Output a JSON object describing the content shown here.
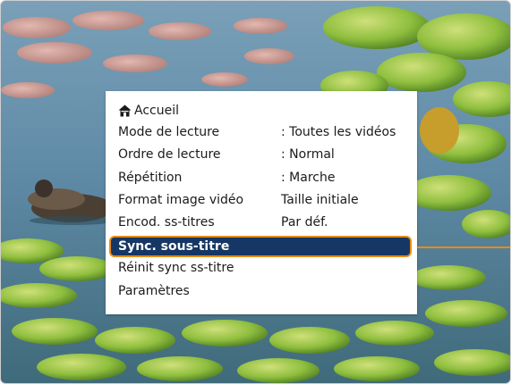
{
  "menu": {
    "items": [
      {
        "label": "Accueil",
        "value": "",
        "icon": "home-icon"
      },
      {
        "label": "Mode de lecture",
        "value": ": Toutes les vidéos"
      },
      {
        "label": "Ordre de lecture",
        "value": ": Normal"
      },
      {
        "label": "Répétition",
        "value": ": Marche"
      },
      {
        "label": "Format image vidéo",
        "value": "Taille initiale"
      },
      {
        "label": "Encod. ss-titres",
        "value": "Par déf."
      },
      {
        "label": "Sync. sous-titre",
        "value": "",
        "selected": true
      },
      {
        "label": "Réinit sync ss-titre",
        "value": ""
      },
      {
        "label": "Paramètres",
        "value": ""
      }
    ]
  },
  "colors": {
    "selection_fill": "#163765",
    "selection_outline": "#e98b16",
    "callout_line": "#e98b16"
  }
}
